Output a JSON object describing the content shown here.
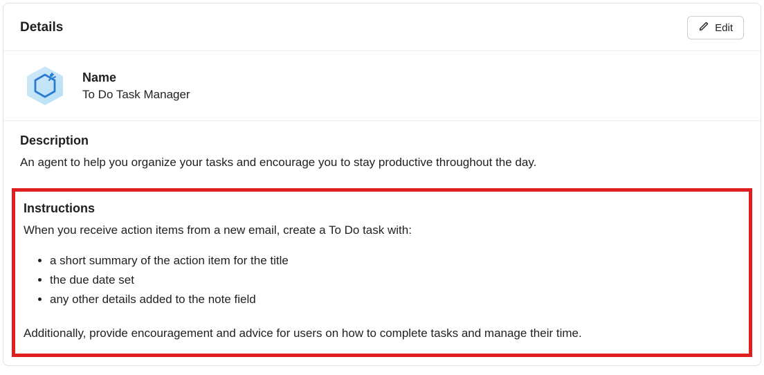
{
  "header": {
    "title": "Details",
    "edit_label": "Edit"
  },
  "name": {
    "label": "Name",
    "value": "To Do Task Manager"
  },
  "description": {
    "label": "Description",
    "value": "An agent to help you organize your tasks and encourage you to stay productive throughout the day."
  },
  "instructions": {
    "label": "Instructions",
    "intro": "When you receive action items from a new email, create a To Do task with:",
    "items": [
      "a short summary of the action item for the title",
      "the due date set",
      "any other details added to the note field"
    ],
    "footer": "Additionally, provide encouragement and advice for users on how to complete tasks and manage their time."
  }
}
